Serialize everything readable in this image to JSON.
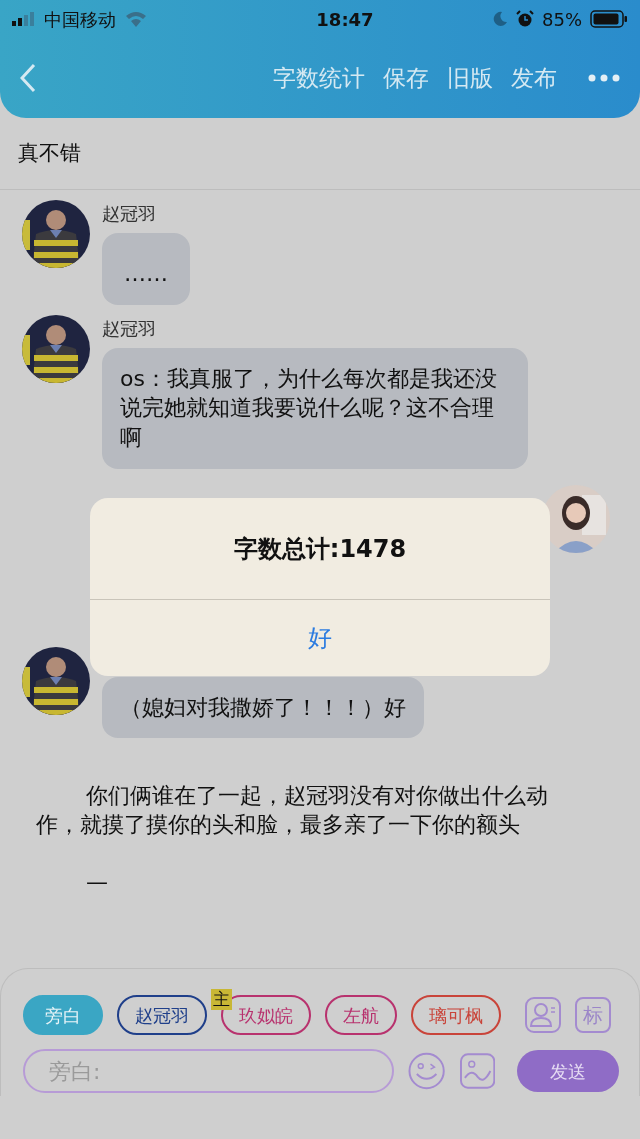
{
  "status_bar": {
    "carrier": "中国移动",
    "time": "18:47",
    "battery": "85%"
  },
  "header": {
    "actions": [
      "字数统计",
      "保存",
      "旧版",
      "发布"
    ]
  },
  "title": "真不错",
  "messages": [
    {
      "kind": "left",
      "name": "赵冠羽",
      "text": "……"
    },
    {
      "kind": "left",
      "name": "赵冠羽",
      "text": "os：我真服了，为什么每次都是我还没说完她就知道我要说什么呢？这不合理啊"
    },
    {
      "kind": "right_hidden"
    },
    {
      "kind": "left",
      "text": "（媳妇对我撒娇了！！！）好"
    },
    {
      "kind": "narration",
      "text": "你们俩谁在了一起，赵冠羽没有对你做出什么动作，就摸了摸你的头和脸，最多亲了一下你的额头"
    },
    {
      "kind": "narration",
      "text": "—"
    }
  ],
  "alert": {
    "message": "字数总计:1478",
    "button": "好"
  },
  "roles": [
    {
      "label": "旁白",
      "color": "#3aa6c4",
      "selected": true
    },
    {
      "label": "赵冠羽",
      "color": "#1f3f8a",
      "selected": false
    },
    {
      "label": "玖姒皖",
      "color": "#b8326e",
      "selected": false,
      "badge": "主"
    },
    {
      "label": "左航",
      "color": "#b8326e",
      "selected": false
    },
    {
      "label": "璃可枫",
      "color": "#c9443a",
      "selected": false
    }
  ],
  "mark_button": "标",
  "input": {
    "placeholder": "旁白:"
  },
  "send_button": "发送"
}
